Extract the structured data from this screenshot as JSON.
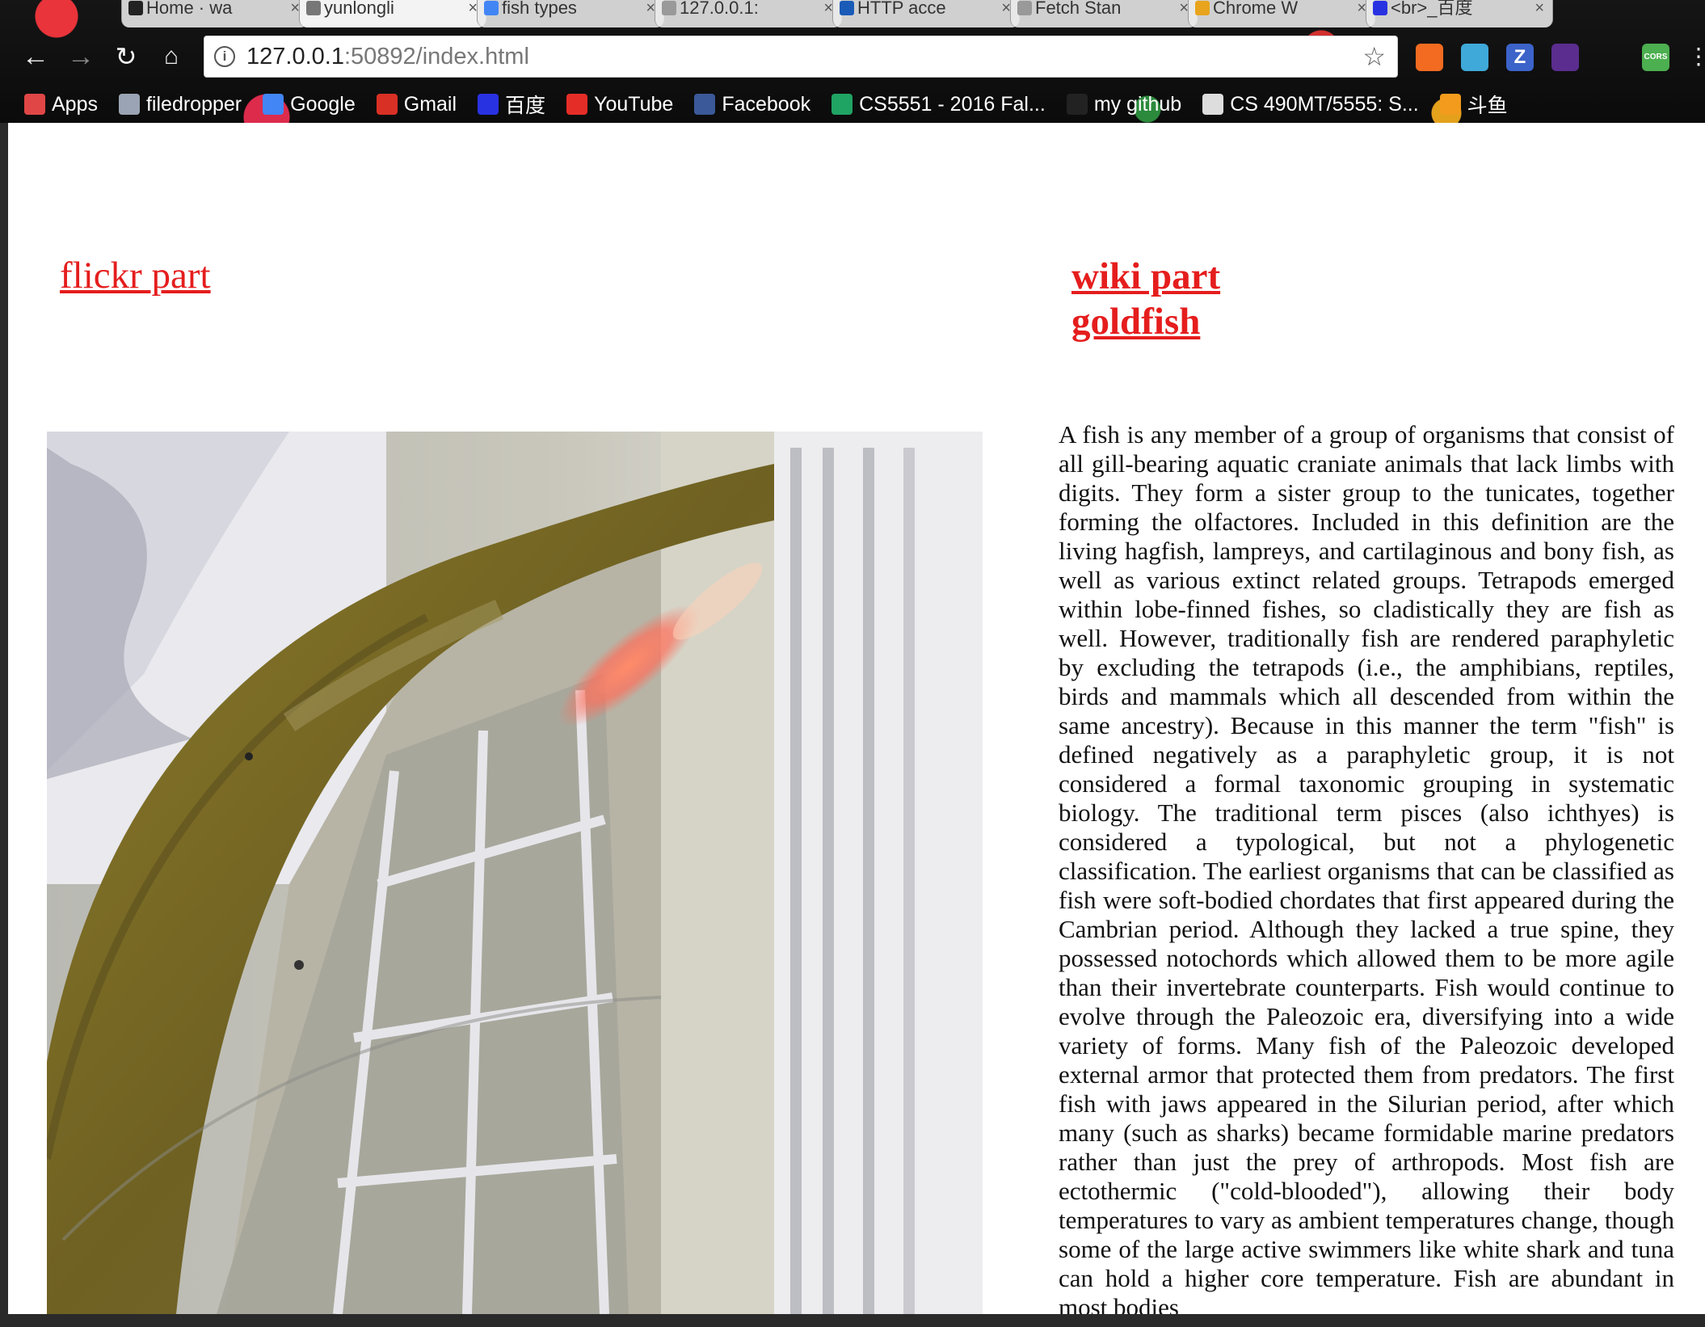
{
  "browser": {
    "tabs": [
      {
        "label": "Home · wa",
        "icon": "github-icon",
        "color": "#222222"
      },
      {
        "label": "yunlongli",
        "icon": "page-icon",
        "color": "#777777",
        "active": true
      },
      {
        "label": "fish types",
        "icon": "google-icon",
        "color": "#4285f4"
      },
      {
        "label": "127.0.0.1:",
        "icon": "page-icon",
        "color": "#999999"
      },
      {
        "label": "HTTP acce",
        "icon": "mdn-icon",
        "color": "#1a5bb8"
      },
      {
        "label": "Fetch Stan",
        "icon": "page-icon",
        "color": "#999999"
      },
      {
        "label": "Chrome W",
        "icon": "chrome-icon",
        "color": "#e8a41c"
      },
      {
        "label": "<br>_百度",
        "icon": "baidu-icon",
        "color": "#2932e1"
      }
    ],
    "url_host": "127.0.0.1",
    "url_path": ":50892/index.html",
    "bookmarks": [
      {
        "label": "Apps",
        "icon": "apps-grid-icon",
        "color": "#e04646"
      },
      {
        "label": "filedropper",
        "icon": "filedropper-icon",
        "color": "#9aa4b4"
      },
      {
        "label": "Google",
        "icon": "google-icon",
        "color": "#4285f4"
      },
      {
        "label": "Gmail",
        "icon": "gmail-icon",
        "color": "#d93025"
      },
      {
        "label": "百度",
        "icon": "baidu-icon",
        "color": "#2932e1"
      },
      {
        "label": "YouTube",
        "icon": "youtube-icon",
        "color": "#e52d27"
      },
      {
        "label": "Facebook",
        "icon": "facebook-icon",
        "color": "#3b5998"
      },
      {
        "label": "CS5551 - 2016 Fal...",
        "icon": "sheets-icon",
        "color": "#1fa463"
      },
      {
        "label": "my github",
        "icon": "github-icon",
        "color": "#222222"
      },
      {
        "label": "CS 490MT/5555: S...",
        "icon": "page-icon",
        "color": "#dddddd"
      },
      {
        "label": "斗鱼",
        "icon": "douyu-icon",
        "color": "#f29b1d"
      }
    ],
    "extensions": [
      {
        "icon": "extension-orange-icon",
        "color": "#f26b21"
      },
      {
        "icon": "extension-globe-icon",
        "color": "#3fa9d9"
      },
      {
        "icon": "zotero-icon",
        "color": "#3c63c9",
        "text": "Z"
      },
      {
        "icon": "extension-meter-icon",
        "color": "#5b2d8f"
      },
      {
        "icon": "cors-icon",
        "color": "#4caf50",
        "text": "CORS"
      }
    ]
  },
  "page": {
    "flickr_heading": "flickr part",
    "wiki_heading": "wiki part",
    "wiki_subheading": "goldfish",
    "article_text": "A fish is any member of a group of organisms that consist of all gill-bearing aquatic craniate animals that lack limbs with digits. They form a sister group to the tunicates, together forming the olfactores. Included in this definition are the living hagfish, lampreys, and cartilaginous and bony fish, as well as various extinct related groups. Tetrapods emerged within lobe-finned fishes, so cladistically they are fish as well. However, traditionally fish are rendered paraphyletic by excluding the tetrapods (i.e., the amphibians, reptiles, birds and mammals which all descended from within the same ancestry). Because in this manner the term \"fish\" is defined negatively as a paraphyletic group, it is not considered a formal taxonomic grouping in systematic biology. The traditional term pisces (also ichthyes) is considered a typological, but not a phylogenetic classification. The earliest organisms that can be classified as fish were soft-bodied chordates that first appeared during the Cambrian period. Although they lacked a true spine, they possessed notochords which allowed them to be more agile than their invertebrate counterparts. Fish would continue to evolve through the Paleozoic era, diversifying into a wide variety of forms. Many fish of the Paleozoic developed external armor that protected them from predators. The first fish with jaws appeared in the Silurian period, after which many (such as sharks) became formidable marine predators rather than just the prey of arthropods. Most fish are ectothermic (\"cold-blooded\"), allowing their body temperatures to vary as ambient temperatures change, though some of the large active swimmers like white shark and tuna can hold a higher core temperature. Fish are abundant in most bodies",
    "link_color": "#e51d1d"
  }
}
